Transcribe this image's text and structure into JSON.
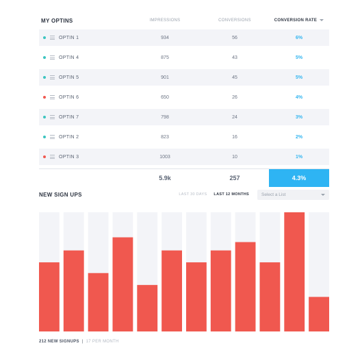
{
  "optins": {
    "title": "MY OPTINS",
    "headers": {
      "impressions": "IMPRESSIONS",
      "conversions": "CONVERSIONS",
      "conversion_rate": "CONVERSION RATE"
    },
    "rows": [
      {
        "name": "OPTIN 1",
        "impressions": "934",
        "conversions": "56",
        "rate": "6%",
        "status_color": "#3cc4c0"
      },
      {
        "name": "OPTIN 4",
        "impressions": "875",
        "conversions": "43",
        "rate": "5%",
        "status_color": "#3cc4c0"
      },
      {
        "name": "OPTIN 5",
        "impressions": "901",
        "conversions": "45",
        "rate": "5%",
        "status_color": "#3cc4c0"
      },
      {
        "name": "OPTIN 6",
        "impressions": "650",
        "conversions": "26",
        "rate": "4%",
        "status_color": "#f0584f"
      },
      {
        "name": "OPTIN 7",
        "impressions": "798",
        "conversions": "24",
        "rate": "3%",
        "status_color": "#3cc4c0"
      },
      {
        "name": "OPTIN 2",
        "impressions": "823",
        "conversions": "16",
        "rate": "2%",
        "status_color": "#3cc4c0"
      },
      {
        "name": "OPTIN 3",
        "impressions": "1003",
        "conversions": "10",
        "rate": "1%",
        "status_color": "#f0584f"
      }
    ],
    "totals": {
      "impressions": "5.9k",
      "conversions": "257",
      "rate": "4.3%"
    }
  },
  "signups": {
    "title": "NEW SIGN UPS",
    "range_30": "LAST 30 DAYS",
    "range_12": "LAST 12 MONTHS",
    "select_placeholder": "Select a List",
    "footer_count": "212 NEW SIGNUPS",
    "footer_sep": "|",
    "footer_rate": "17 PER MONTH"
  },
  "chart_data": {
    "type": "bar",
    "ylim": [
      0,
      1
    ],
    "values": [
      0.58,
      0.68,
      0.49,
      0.79,
      0.39,
      0.68,
      0.58,
      0.68,
      0.75,
      0.58,
      1.0,
      0.29
    ],
    "bar_color": "#f0584f",
    "track_color": "#f3f4f8"
  }
}
